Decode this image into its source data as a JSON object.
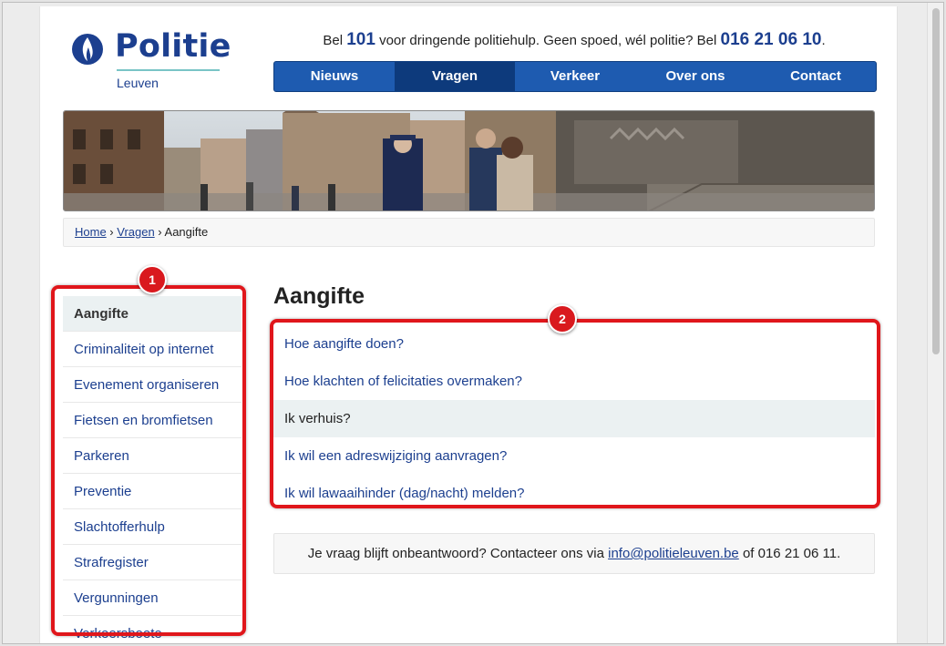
{
  "logo": {
    "word": "Politie",
    "city": "Leuven"
  },
  "phone": {
    "pre": "Bel ",
    "emergency": "101",
    "mid": " voor dringende politiehulp. Geen spoed, wél politie? Bel ",
    "number": "016 21 06 10",
    "post": "."
  },
  "nav": {
    "items": [
      {
        "label": "Nieuws"
      },
      {
        "label": "Vragen"
      },
      {
        "label": "Verkeer"
      },
      {
        "label": "Over ons"
      },
      {
        "label": "Contact"
      }
    ],
    "active_index": 1
  },
  "breadcrumb": {
    "home": "Home",
    "sep": " › ",
    "section": "Vragen",
    "current": "Aangifte"
  },
  "sidebar": {
    "items": [
      {
        "label": "Aangifte"
      },
      {
        "label": "Criminaliteit op internet"
      },
      {
        "label": "Evenement organiseren"
      },
      {
        "label": "Fietsen en bromfietsen"
      },
      {
        "label": "Parkeren"
      },
      {
        "label": "Preventie"
      },
      {
        "label": "Slachtofferhulp"
      },
      {
        "label": "Strafregister"
      },
      {
        "label": "Vergunningen"
      },
      {
        "label": "Verkeersboete"
      }
    ],
    "active_index": 0
  },
  "main": {
    "title": "Aangifte",
    "questions": [
      {
        "label": "Hoe aangifte doen?"
      },
      {
        "label": "Hoe klachten of felicitaties overmaken?"
      },
      {
        "label": "Ik verhuis?"
      },
      {
        "label": "Ik wil een adreswijziging aanvragen?"
      },
      {
        "label": "Ik wil lawaaihinder (dag/nacht) melden?"
      }
    ],
    "active_index": 2
  },
  "contact": {
    "pre": "Je vraag blijft onbeantwoord? Contacteer ons via ",
    "email": "info@politieleuven.be",
    "post": " of 016 21 06 11."
  },
  "annotations": {
    "badge1": "1",
    "badge2": "2",
    "color": "#e0161b"
  },
  "colors": {
    "brand": "#1c3f8f",
    "nav": "#1e5bb0",
    "nav_active": "#0d3a7c",
    "highlight_bg": "#ebf1f2"
  }
}
